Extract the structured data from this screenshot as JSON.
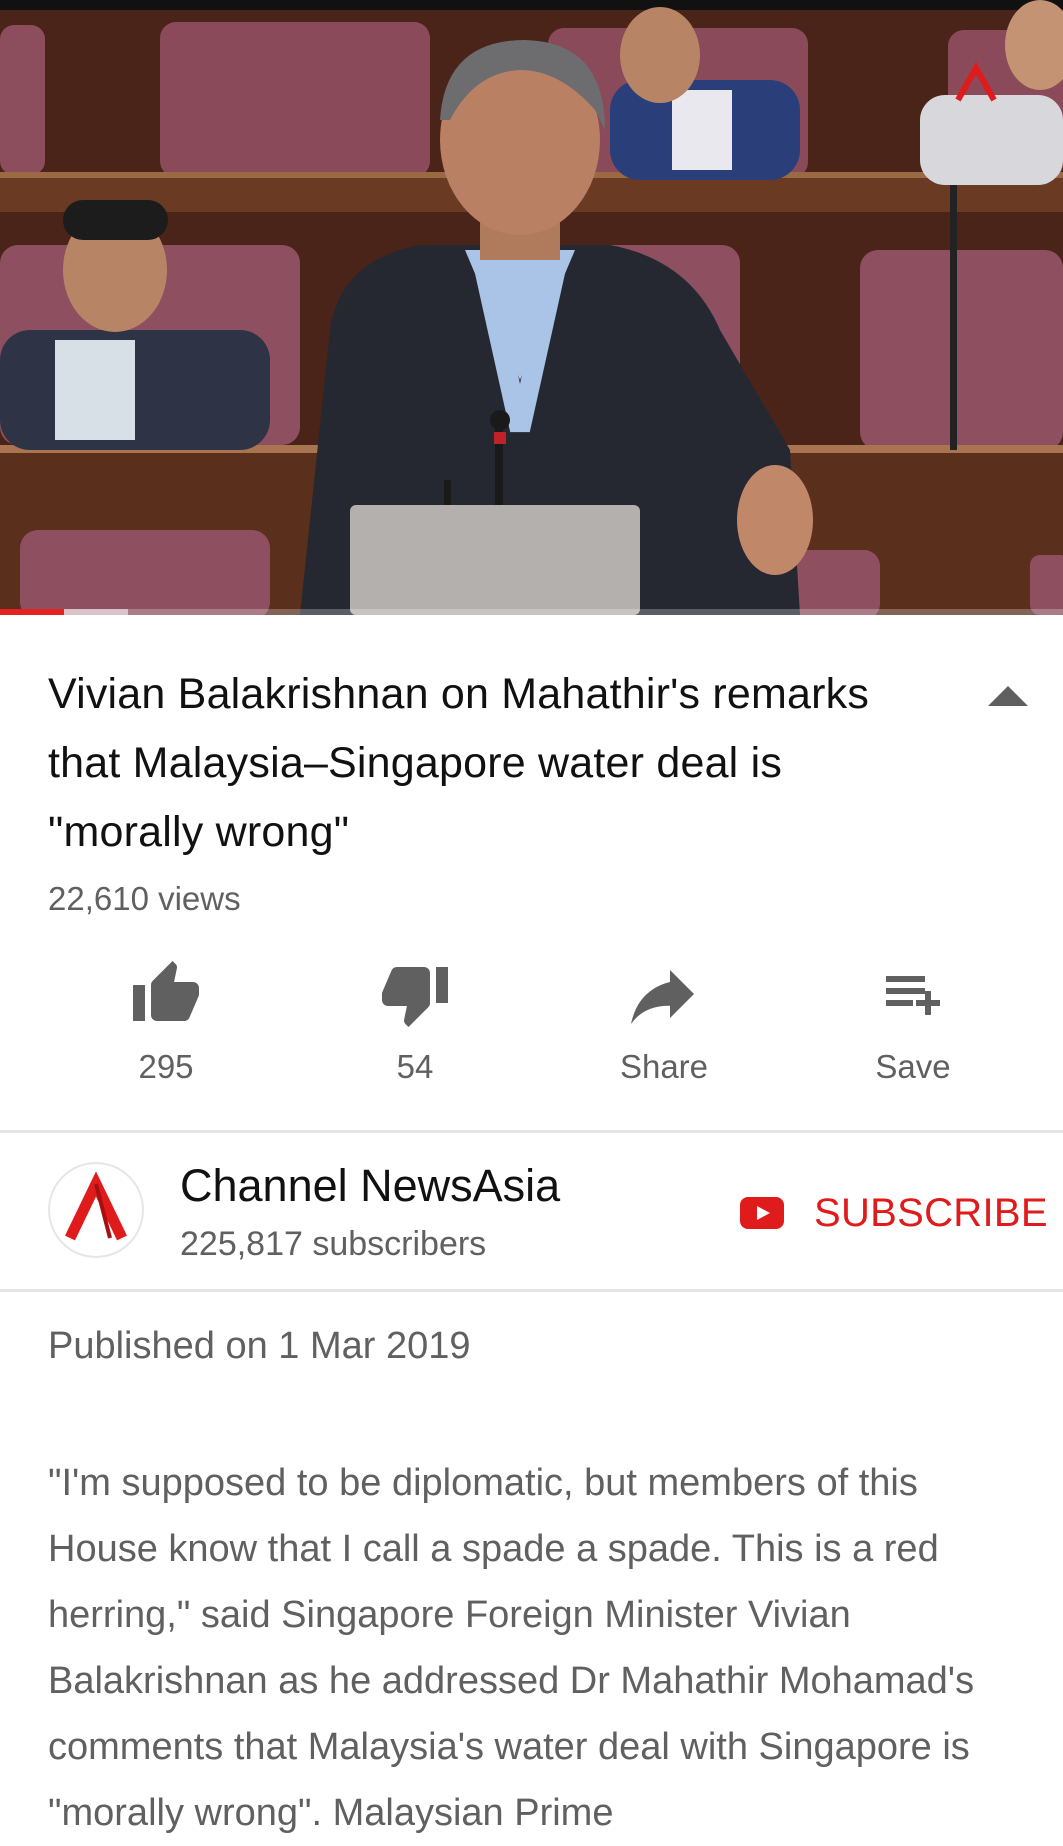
{
  "video": {
    "thumbnail": "parliament-speech-frame",
    "progress_fraction": 0.06,
    "buffered_fraction": 0.12,
    "player_color": "#e52222"
  },
  "title": "Vivian Balakrishnan on Mahathir's remarks that Malaysia–Singapore water deal is \"morally wrong\"",
  "views": "22,610 views",
  "collapse_icon": "caret-up-icon",
  "actions": [
    {
      "icon": "thumbs-up-icon",
      "label": "295"
    },
    {
      "icon": "thumbs-down-icon",
      "label": "54"
    },
    {
      "icon": "share-icon",
      "label": "Share"
    },
    {
      "icon": "playlist-add-icon",
      "label": "Save"
    }
  ],
  "channel": {
    "name": "Channel NewsAsia",
    "subscribers": "225,817 subscribers",
    "logo_color": "#e01b1b"
  },
  "subscribe": {
    "label": "SUBSCRIBE",
    "color": "#e01b1b"
  },
  "published": "Published on 1 Mar 2019",
  "description": "\"I'm supposed to be diplomatic, but members of this House know that I call a spade a spade. This is a red herring,\" said Singapore Foreign Minister Vivian Balakrishnan as he addressed Dr Mahathir Mohamad's comments that Malaysia's water deal with Singapore is \"morally wrong\". Malaysian Prime"
}
